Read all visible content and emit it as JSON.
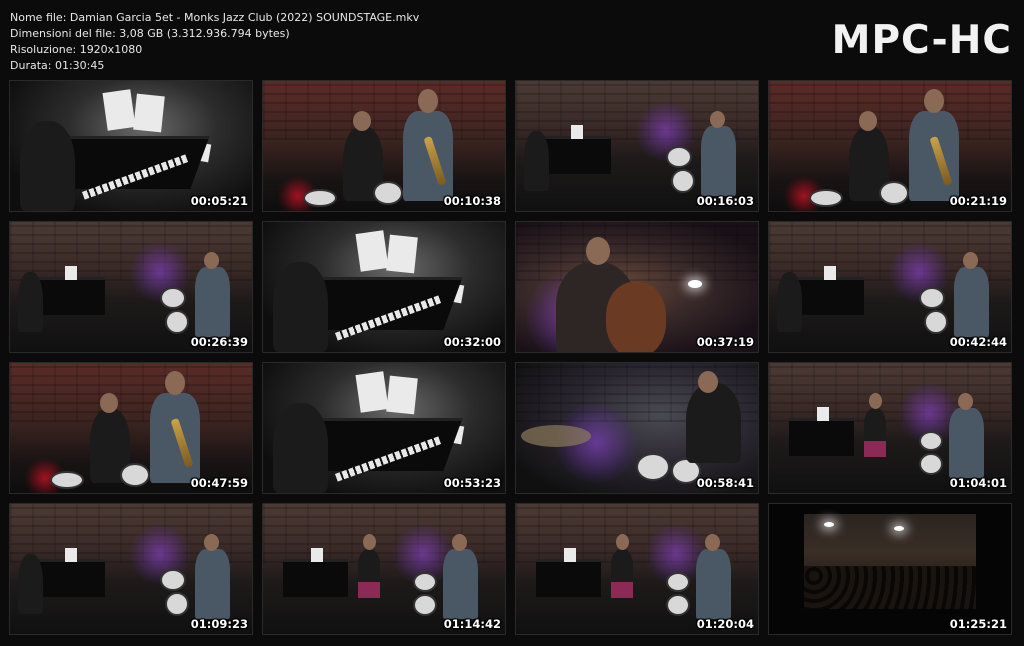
{
  "info": {
    "filename": "Nome file: Damian Garcia 5et - Monks Jazz Club (2022) SOUNDSTAGE.mkv",
    "filesize": "Dimensioni del file: 3,08 GB (3.312.936.794 bytes)",
    "resolution": "Risoluzione: 1920x1080",
    "duration": "Durata: 01:30:45"
  },
  "logo": "MPC-HC",
  "thumbnails": [
    {
      "time": "00:05:21",
      "scene": "piano-close"
    },
    {
      "time": "00:10:38",
      "scene": "duo"
    },
    {
      "time": "00:16:03",
      "scene": "wide"
    },
    {
      "time": "00:21:19",
      "scene": "duo"
    },
    {
      "time": "00:26:39",
      "scene": "wide"
    },
    {
      "time": "00:32:00",
      "scene": "piano-close"
    },
    {
      "time": "00:37:19",
      "scene": "bass"
    },
    {
      "time": "00:42:44",
      "scene": "wide"
    },
    {
      "time": "00:47:59",
      "scene": "duo"
    },
    {
      "time": "00:53:23",
      "scene": "piano-close"
    },
    {
      "time": "00:58:41",
      "scene": "drums"
    },
    {
      "time": "01:04:01",
      "scene": "wide-singer"
    },
    {
      "time": "01:09:23",
      "scene": "wide"
    },
    {
      "time": "01:14:42",
      "scene": "wide-singer"
    },
    {
      "time": "01:20:04",
      "scene": "wide-singer"
    },
    {
      "time": "01:25:21",
      "scene": "crowd"
    }
  ]
}
